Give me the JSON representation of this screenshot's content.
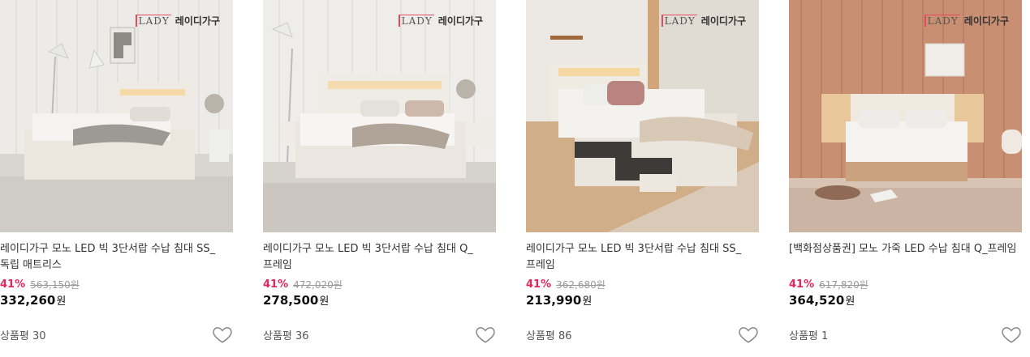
{
  "brand": {
    "mark": "LADY",
    "name": "레이디가구",
    "accent": "#e34b5c"
  },
  "colors": {
    "discount": "#e2265b",
    "original_price": "#9a9a9a"
  },
  "products": [
    {
      "title": "레이디가구 모노 LED 빅 3단서랍 수납 침대 SS_독립 매트리스",
      "discount": "41%",
      "original_price": "563,150원",
      "sale_price": "332,260",
      "currency": "원",
      "review_label": "상품평",
      "review_count": "30",
      "wishlist_icon": "heart-outline-icon"
    },
    {
      "title": "레이디가구 모노 LED 빅 3단서랍 수납 침대 Q_프레임",
      "discount": "41%",
      "original_price": "472,020원",
      "sale_price": "278,500",
      "currency": "원",
      "review_label": "상품평",
      "review_count": "36",
      "wishlist_icon": "heart-outline-icon"
    },
    {
      "title": "레이디가구 모노 LED 빅 3단서랍 수납 침대 SS_프레임",
      "discount": "41%",
      "original_price": "362,680원",
      "sale_price": "213,990",
      "currency": "원",
      "review_label": "상품평",
      "review_count": "86",
      "wishlist_icon": "heart-outline-icon"
    },
    {
      "title": "[백화점상품권] 모노 가죽 LED 수납 침대 Q_프레임",
      "discount": "41%",
      "original_price": "617,820원",
      "sale_price": "364,520",
      "currency": "원",
      "review_label": "상품평",
      "review_count": "1",
      "wishlist_icon": "heart-outline-icon"
    }
  ]
}
